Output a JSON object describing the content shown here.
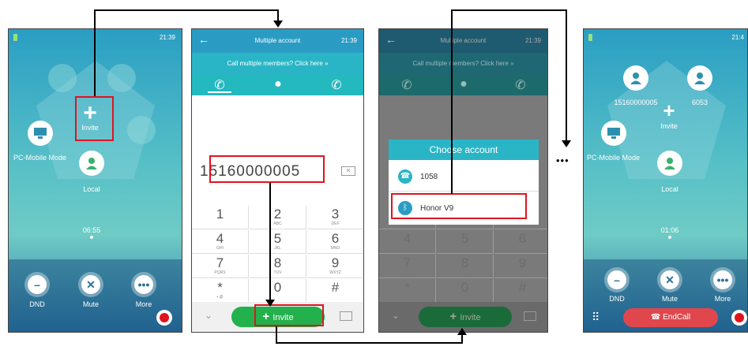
{
  "screen1": {
    "time": "21:39",
    "invite": "Invite",
    "pc_mode": "PC-Mobile Mode",
    "local": "Local",
    "duration": "06:55",
    "dnd": "DND",
    "mute": "Mute",
    "more": "More"
  },
  "screen2": {
    "title": "Multiple account",
    "time": "21:39",
    "prompt": "Call multiple members? Click here  »",
    "number": "15160000005",
    "keys": [
      [
        "1",
        ""
      ],
      [
        "2",
        "ABC"
      ],
      [
        "3",
        "DEF"
      ],
      [
        "4",
        "GHI"
      ],
      [
        "5",
        "JKL"
      ],
      [
        "6",
        "MNO"
      ],
      [
        "7",
        "PQRS"
      ],
      [
        "8",
        "TUV"
      ],
      [
        "9",
        "WXYZ"
      ],
      [
        "*",
        "• @"
      ],
      [
        "0",
        ""
      ],
      [
        "#",
        ""
      ]
    ],
    "invite": "Invite"
  },
  "screen3": {
    "title": "Multiple account",
    "time": "21:39",
    "prompt": "Call multiple members? Click here  »",
    "dialog_title": "Choose account",
    "accounts": [
      "1058",
      "Honor V9"
    ],
    "invite": "Invite"
  },
  "screen4": {
    "time": "21:4",
    "member1": "15160000005",
    "member2": "6053",
    "invite": "Invite",
    "pc_mode": "PC-Mobile Mode",
    "local": "Local",
    "duration": "01:06",
    "dnd": "DND",
    "mute": "Mute",
    "more": "More",
    "endcall": "EndCall"
  },
  "ellipsis": "•••",
  "colors": {
    "highlight": "#e0141e",
    "accent": "#2ab5c6",
    "green": "#22b14c",
    "endcall": "#e0474c"
  }
}
